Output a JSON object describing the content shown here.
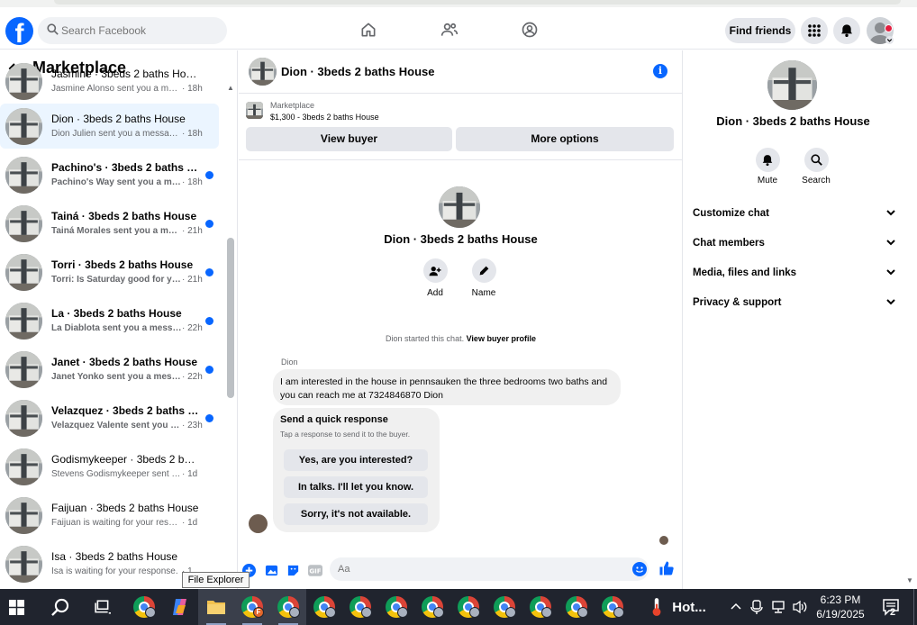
{
  "header": {
    "search_placeholder": "Search Facebook",
    "find_friends": "Find friends"
  },
  "sidebar": {
    "title": "Marketplace",
    "conversations": [
      {
        "name": "Jasmine · 3beds 2 baths House",
        "preview": "Jasmine Alonso sent you a messa...",
        "time": "· 18h",
        "unread": false
      },
      {
        "name": "Dion · 3beds 2 baths House",
        "preview": "Dion Julien sent you a message a...",
        "time": "· 18h",
        "unread": false
      },
      {
        "name": "Pachino's · 3beds 2 baths House",
        "preview": "Pachino's Way sent you a mes...",
        "time": "· 18h",
        "unread": true
      },
      {
        "name": "Tainá · 3beds 2 baths House",
        "preview": "Tainá Morales sent you a mess...",
        "time": "· 21h",
        "unread": true
      },
      {
        "name": "Torri · 3beds 2 baths House",
        "preview": "Torri: Is Saturday good for you",
        "time": "· 21h",
        "unread": true
      },
      {
        "name": "La · 3beds 2 baths House",
        "preview": "La Diablota sent you a messag...",
        "time": "· 22h",
        "unread": true
      },
      {
        "name": "Janet · 3beds 2 baths House",
        "preview": "Janet Yonko sent you a messa...",
        "time": "· 22h",
        "unread": true
      },
      {
        "name": "Velazquez · 3beds 2 baths House",
        "preview": "Velazquez Valente sent you a ...",
        "time": "· 23h",
        "unread": true
      },
      {
        "name": "Godismykeeper · 3beds 2 baths House",
        "preview": "Stevens Godismykeeper sent you ...",
        "time": "· 1d",
        "unread": false
      },
      {
        "name": "Faijuan · 3beds 2 baths House",
        "preview": "Faijuan is waiting for your response.",
        "time": "· 1d",
        "unread": false
      },
      {
        "name": "Isa · 3beds 2 baths House",
        "preview": "Isa is waiting for your response.",
        "time": "· 1",
        "unread": false
      }
    ]
  },
  "chat": {
    "title": "Dion · 3beds 2 baths House",
    "marketplace_label": "Marketplace",
    "listing": "$1,300 - 3beds 2 baths House",
    "view_buyer": "View buyer",
    "more_options": "More options",
    "name": "Dion · 3beds 2 baths House",
    "add_label": "Add",
    "name_label": "Name",
    "started_text": "Dion started this chat.",
    "view_buyer_profile": "View buyer profile",
    "sender": "Dion",
    "message": "I am interested in the house in pennsauken the three bedrooms two baths and you can reach me at  7324846870 Dion",
    "quick_title": "Send a quick response",
    "quick_sub": "Tap a response to send it to the buyer.",
    "quick_responses": [
      "Yes, are you interested?",
      "In talks. I'll let you know.",
      "Sorry, it's not available."
    ],
    "input_placeholder": "Aa"
  },
  "tooltip": "File Explorer",
  "details": {
    "name": "Dion · 3beds 2 baths House",
    "mute": "Mute",
    "search": "Search",
    "sections": [
      "Customize chat",
      "Chat members",
      "Media, files and links",
      "Privacy & support"
    ]
  },
  "taskbar": {
    "weather": "Hot...",
    "time": "6:23 PM",
    "date": "6/19/2025",
    "notifications": "2"
  },
  "colors": {
    "brand": "#0866ff",
    "active_row": "#ebf5ff",
    "unread_dot": "#0866ff"
  }
}
